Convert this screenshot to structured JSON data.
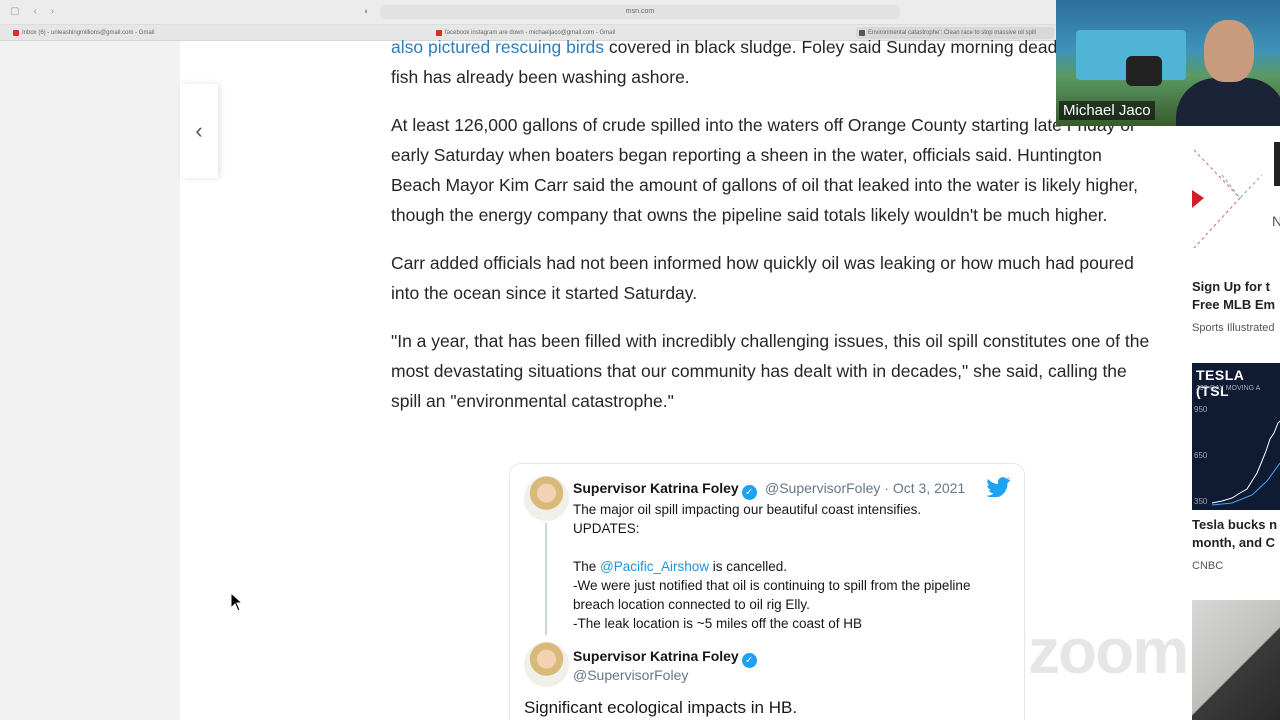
{
  "browser": {
    "url": "msn.com",
    "tabs": [
      {
        "label": "Inbox (6) - unleashingmillions@gmail.com - Gmail",
        "color": "#d93025"
      },
      {
        "label": "facebook instagram are down - michaeljaco@gmail.com - Gmail",
        "color": "#d93025"
      },
      {
        "label": "Environmental catastrophe': Clean race to stop massive oil spill",
        "color": "#555555"
      }
    ]
  },
  "article": {
    "p1_link": "also pictured rescuing birds",
    "p1_text": " covered in black sludge. Foley said Sunday morning dead birds and fish has already been washing ashore.",
    "p2": "At least 126,000 gallons of crude spilled into the waters off Orange County starting late Friday or early Saturday when boaters began reporting a sheen in the water, officials said. Huntington Beach Mayor Kim Carr said the amount of gallons of oil that leaked into the water is likely higher, though the energy company that owns the pipeline said totals likely wouldn't be much higher.",
    "p3": "Carr added officials had not been informed how quickly oil was leaking or how much had poured into the ocean since it started Saturday.",
    "p4": "\"In a year, that has been filled with incredibly challenging issues, this oil spill constitutes one of the most devastating situations that our community has dealt with in decades,\" she said, calling the spill an \"environmental catastrophe.\""
  },
  "tweet": {
    "name": "Supervisor Katrina Foley",
    "handle": "@SupervisorFoley",
    "separator": "·",
    "date": "Oct 3, 2021",
    "line1": "The major oil spill impacting our beautiful coast intensifies.",
    "line2": "UPDATES:",
    "line3_pre": "The ",
    "mention": "@Pacific_Airshow",
    "line3_post": " is cancelled.",
    "line4": "-We were just notified that oil is continuing to spill from the pipeline breach location connected to oil rig Elly.",
    "line5": "-The leak location is ~5 miles off the coast of HB",
    "quoted_name": "Supervisor Katrina Foley",
    "quoted_handle": "@SupervisorFoley",
    "quoted_text": "Significant ecological impacts in HB.",
    "twitter_blue": "#1da1f2"
  },
  "rail": {
    "card1_title_line1": "Sign Up for t",
    "card1_title_line2": "Free MLB Em",
    "card1_source": "Sports Illustrated",
    "tesla_thumb_title": "TESLA (TSL",
    "tesla_thumb_sub": "200-DAY MOVING A",
    "tesla_axis": [
      "950",
      "650",
      "350"
    ],
    "card2_title_line1": "Tesla bucks n",
    "card2_title_line2": "month, and C",
    "card2_source": "CNBC"
  },
  "webcam": {
    "name": "Michael Jaco"
  },
  "watermark": "zoom"
}
